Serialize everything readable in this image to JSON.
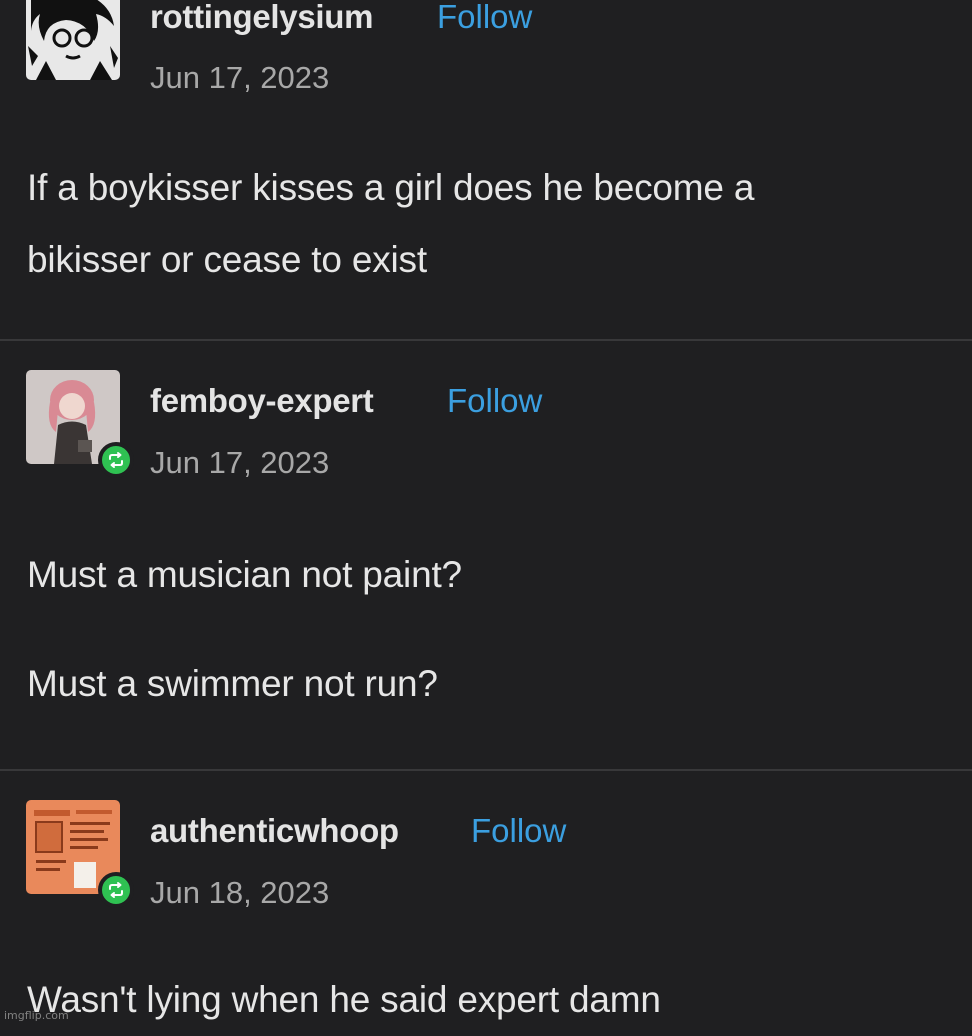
{
  "posts": [
    {
      "username": "rottingelysium",
      "follow_label": "Follow",
      "date": "Jun 17, 2023",
      "reblogged": false,
      "avatar_icon": "sketch-face-avatar",
      "body": [
        "If a boykisser kisses a girl does he become a",
        "bikisser or cease to exist"
      ]
    },
    {
      "username": "femboy-expert",
      "follow_label": "Follow",
      "date": "Jun 17, 2023",
      "reblogged": true,
      "avatar_icon": "anime-character-avatar",
      "body": [
        "Must a musician not paint?",
        "Must a swimmer not run?"
      ]
    },
    {
      "username": "authenticwhoop",
      "follow_label": "Follow",
      "date": "Jun 18, 2023",
      "reblogged": true,
      "avatar_icon": "orange-card-avatar",
      "body": [
        "Wasn't lying when he said expert damn"
      ]
    }
  ],
  "watermark": "imgflip.com",
  "colors": {
    "background": "#1f1f21",
    "follow_link": "#3b9fe0",
    "reblog_badge": "#2fc152",
    "divider": "#38383a"
  }
}
